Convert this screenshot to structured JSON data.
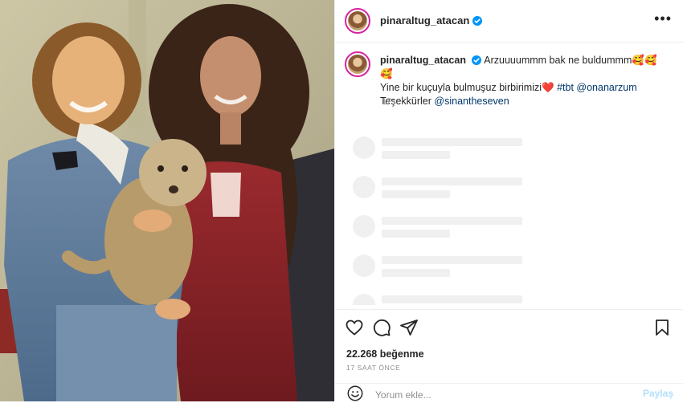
{
  "post": {
    "username": "pinaraltug_atacan",
    "caption": {
      "username": "pinaraltug_atacan",
      "line1": "Arzuuuummm bak ne buldummm",
      "line1_emojis": "🥰🥰🥰",
      "line2": "Yine bir kuçuyla bulmuşuz birbirimizi",
      "heart": "❤️",
      "tag": "#tbt",
      "mention1": "@onanarzum",
      "line3": "Teşekkürler",
      "mention2": "@sinantheseven"
    },
    "time_ago": "17s",
    "likes": "22.268 beğenme",
    "posted": "17 SAAT ÖNCE",
    "comment_placeholder": "Yorum ekle...",
    "share_label": "Paylaş",
    "more_label": "•••"
  },
  "icons": {
    "verified": "verified-badge-icon",
    "like": "heart-icon",
    "comment": "comment-icon",
    "send": "share-icon",
    "save": "bookmark-icon",
    "emoji": "emoji-icon",
    "more": "more-options-icon"
  },
  "colors": {
    "verified_blue": "#0095f6",
    "link": "#00376b",
    "muted": "#8e8e8e",
    "heart_red": "#ed1c24"
  }
}
